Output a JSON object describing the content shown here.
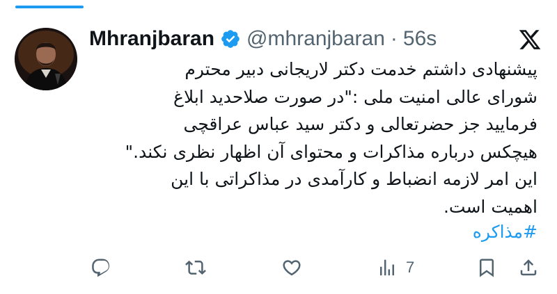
{
  "author": {
    "display_name": "Mhranjbaran",
    "handle": "@mhranjbaran",
    "separator": "·",
    "time": "56s",
    "verified": true
  },
  "tweet": {
    "lines": [
      "پیشنهادی داشتم خدمت دکتر لاریجانی دبیر محترم",
      "شورای عالی امنیت ملی :\"در صورت صلاحدید ابلاغ",
      "فرمایید جز حضرتعالی و دکتر سید عباس عراقچی",
      "هیچکس درباره مذاکرات و محتوای آن اظهار نظری نکند.\"",
      "این امر لازمه انضباط و کارآمدی در مذاکراتی با این",
      "اهمیت است."
    ],
    "hashtag": "#مذاکره"
  },
  "actions": {
    "reply_icon": "reply-icon",
    "retweet_icon": "retweet-icon",
    "like_icon": "heart-icon",
    "views_icon": "views-chart-icon",
    "views_count": "7",
    "bookmark_icon": "bookmark-icon",
    "share_icon": "share-icon"
  },
  "colors": {
    "accent": "#1d9bf0",
    "text": "#0f1419",
    "muted": "#536471"
  }
}
